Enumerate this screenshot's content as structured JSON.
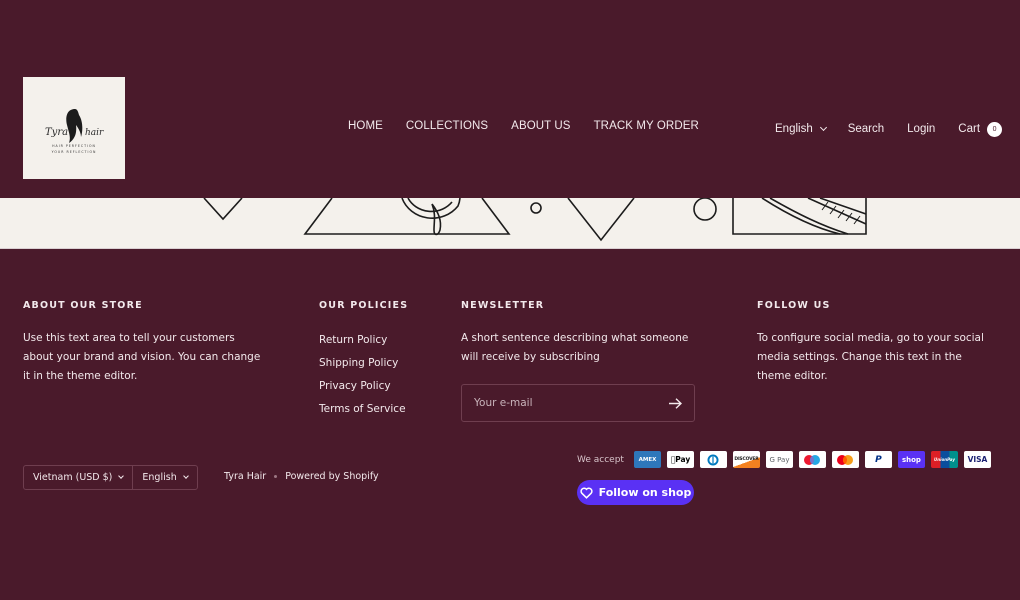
{
  "header": {
    "logo": {
      "alt": "Tyra Hair",
      "brand_left": "Tyra",
      "brand_right": "hair",
      "tagline_line1": "HAIR PERFECTION",
      "tagline_line2": "YOUR REFLECTION"
    },
    "nav": [
      {
        "label": "HOME"
      },
      {
        "label": "COLLECTIONS"
      },
      {
        "label": "ABOUT US"
      },
      {
        "label": "TRACK MY ORDER"
      }
    ],
    "language": "English",
    "search_label": "Search",
    "login_label": "Login",
    "cart_label": "Cart",
    "cart_count": "0"
  },
  "footer": {
    "about": {
      "heading": "ABOUT OUR STORE",
      "text": "Use this text area to tell your customers about your brand and vision. You can change it in the theme editor."
    },
    "policies": {
      "heading": "OUR POLICIES",
      "links": [
        {
          "label": "Return Policy"
        },
        {
          "label": "Shipping Policy"
        },
        {
          "label": "Privacy Policy"
        },
        {
          "label": "Terms of Service"
        }
      ]
    },
    "newsletter": {
      "heading": "NEWSLETTER",
      "text": "A short sentence describing what someone will receive by subscribing",
      "email_placeholder": "Your e-mail",
      "email_value": ""
    },
    "follow": {
      "heading": "FOLLOW US",
      "text": "To configure social media, go to your social media settings. Change this text in the theme editor."
    },
    "country_selector": "Vietnam (USD $)",
    "language_selector": "English",
    "store_name": "Tyra Hair",
    "powered_by": "Powered by Shopify",
    "we_accept": "We accept",
    "payment_methods": [
      {
        "name": "American Express",
        "label": "AMEX",
        "icon": "amex-icon"
      },
      {
        "name": "Apple Pay",
        "label": "Pay",
        "icon": "apple-pay-icon"
      },
      {
        "name": "Diners Club",
        "label": "",
        "icon": "diners-club-icon"
      },
      {
        "name": "Discover",
        "label": "DISCOVER",
        "icon": "discover-icon"
      },
      {
        "name": "Google Pay",
        "label": "G Pay",
        "icon": "google-pay-icon"
      },
      {
        "name": "Maestro",
        "label": "",
        "icon": "maestro-icon"
      },
      {
        "name": "Mastercard",
        "label": "",
        "icon": "mastercard-icon"
      },
      {
        "name": "PayPal",
        "label": "P",
        "icon": "paypal-icon"
      },
      {
        "name": "Shop Pay",
        "label": "shop",
        "icon": "shop-pay-icon"
      },
      {
        "name": "UnionPay",
        "label": "UnionPay",
        "icon": "unionpay-icon"
      },
      {
        "name": "Visa",
        "label": "VISA",
        "icon": "visa-icon"
      }
    ],
    "follow_shop_label": "Follow on shop"
  },
  "colors": {
    "background": "#4a1a2b",
    "banner": "#f4f1ec",
    "shop_accent": "#5a31f4",
    "text": "#f3e9ec"
  }
}
